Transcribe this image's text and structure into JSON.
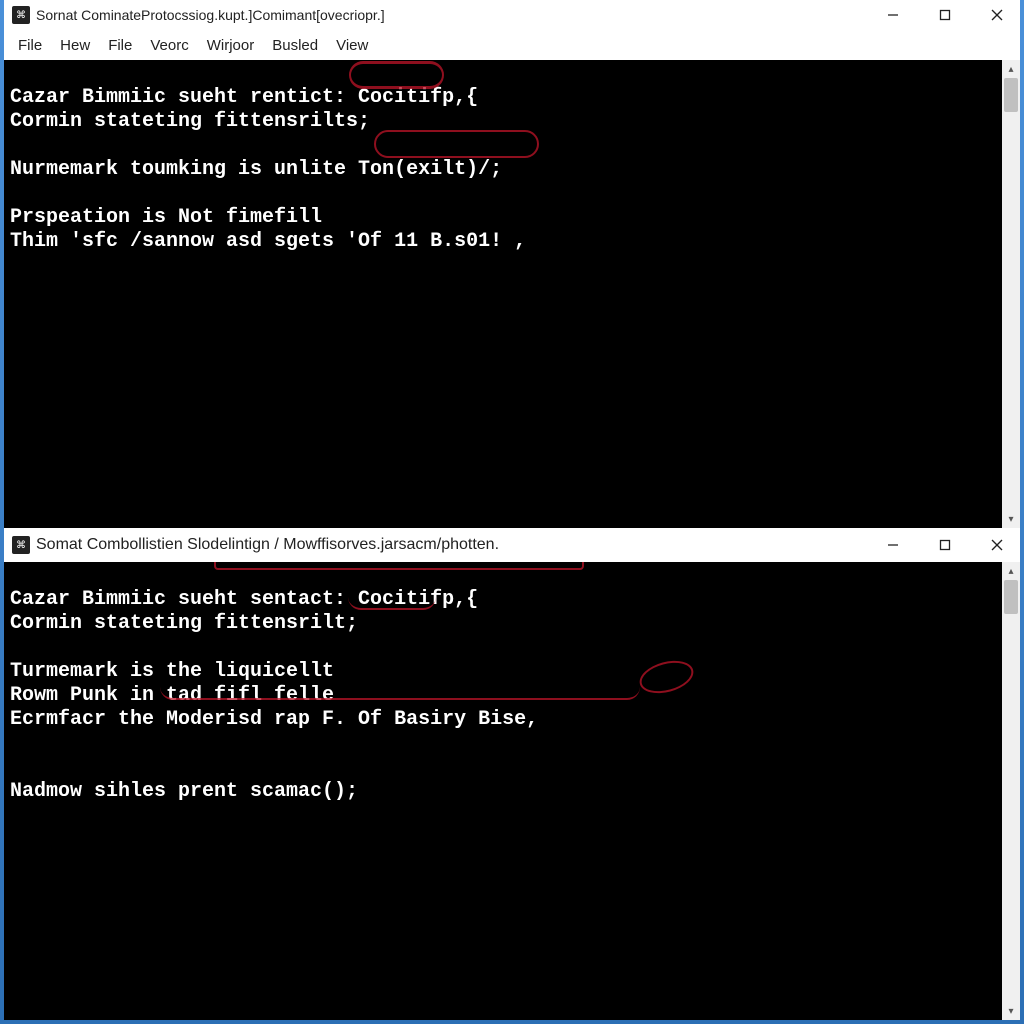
{
  "window1": {
    "title": "Sornat CominateProtocssiog.kupt.]Comimant[ovecriopr.]",
    "menu": [
      "File",
      "Hew",
      "File",
      "Veorc",
      "Wirjoor",
      "Busled",
      "View"
    ],
    "lines": [
      "Cazar Bimmiic sueht rentict: Cocitifp,{",
      "Cormin stateting fittensrilts;",
      "",
      "Nurmemark toumking is unlite Ton(exilt)/;",
      "",
      "Prspeation is Not fimefill",
      "Thim 'sfc /sannow asd sgets 'Of 11 B.s01! ,"
    ]
  },
  "window2": {
    "title": "Somat Combollistien Slodelintign / Mowffisorves.jarsacm/photten.",
    "lines": [
      "Cazar Bimmiic sueht sentact: Cocitifp,{",
      "Cormin stateting fittensrilt;",
      "",
      "Turmemark is the liquicellt",
      "Rowm Punk in tad fifl felle",
      "Ecrmfacr the Moderisd rap F. Of Basiry Bise,",
      "",
      "",
      "Nadmow sihles prent scamac();"
    ]
  }
}
